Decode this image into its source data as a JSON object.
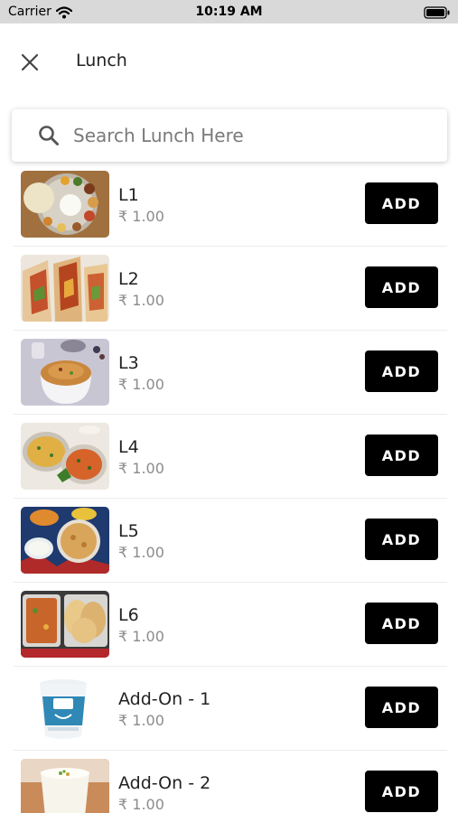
{
  "status_bar": {
    "carrier": "Carrier",
    "time": "10:19 AM"
  },
  "header": {
    "title": "Lunch"
  },
  "search": {
    "placeholder": "Search Lunch Here",
    "value": ""
  },
  "add_label": "ADD",
  "items": [
    {
      "name": "L1",
      "price": "₹ 1.00",
      "image": "thali-plate"
    },
    {
      "name": "L2",
      "price": "₹ 1.00",
      "image": "wraps"
    },
    {
      "name": "L3",
      "price": "₹ 1.00",
      "image": "rice-bowl"
    },
    {
      "name": "L4",
      "price": "₹ 1.00",
      "image": "noodles"
    },
    {
      "name": "L5",
      "price": "₹ 1.00",
      "image": "paratha-meal"
    },
    {
      "name": "L6",
      "price": "₹ 1.00",
      "image": "curry-chapati"
    },
    {
      "name": "Add-On - 1",
      "price": "₹ 1.00",
      "image": "curd-cup"
    },
    {
      "name": "Add-On - 2",
      "price": "₹ 1.00",
      "image": "lassi-glass"
    }
  ]
}
